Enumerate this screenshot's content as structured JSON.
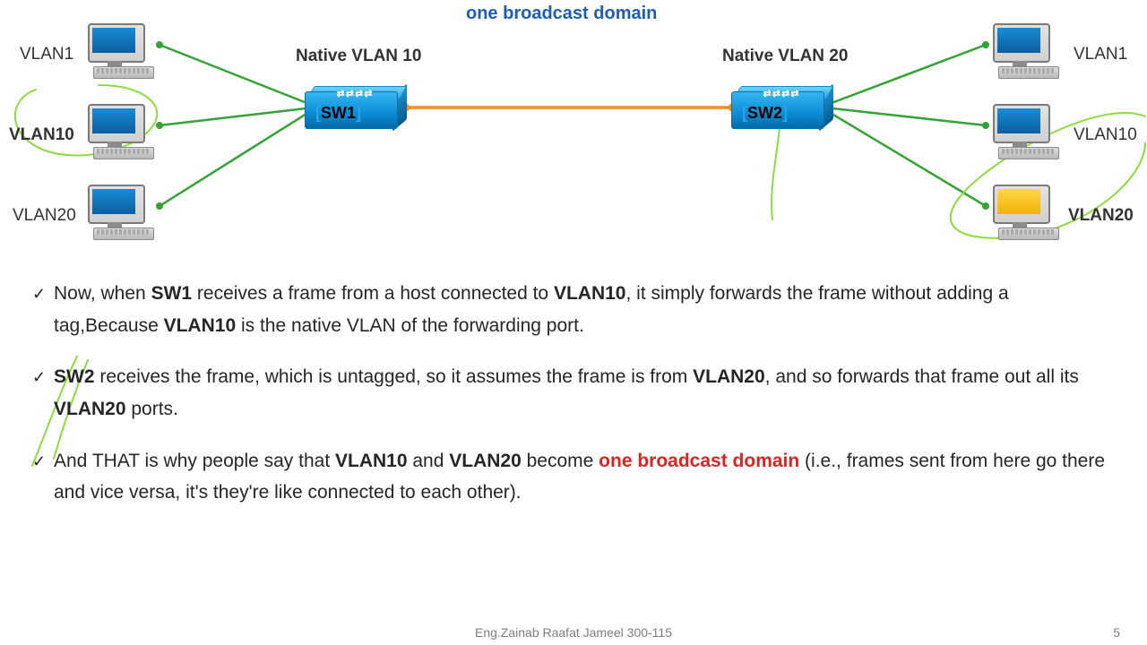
{
  "title": "one broadcast domain",
  "left_pcs": {
    "vlan1": "VLAN1",
    "vlan10": "VLAN10",
    "vlan20": "VLAN20"
  },
  "right_pcs": {
    "vlan1": "VLAN1",
    "vlan10": "VLAN10",
    "vlan20": "VLAN20"
  },
  "sw1": {
    "native": "Native VLAN 10",
    "name": "SW1"
  },
  "sw2": {
    "native": "Native VLAN 20",
    "name": "SW2"
  },
  "bullets": {
    "b1_a": "Now, when ",
    "b1_sw1": "SW1",
    "b1_b": " receives a frame from a host connected to ",
    "b1_v10a": "VLAN10",
    "b1_c": ", it simply forwards the frame without adding a tag,Because ",
    "b1_v10b": "VLAN10",
    "b1_d": " is the native VLAN of the forwarding port.",
    "b2_sw2": "SW2",
    "b2_a": " receives the frame, which is untagged, so it assumes the frame is from ",
    "b2_v20a": "VLAN20",
    "b2_b": ", and so forwards that frame out all its ",
    "b2_v20b": "VLAN20",
    "b2_c": " ports.",
    "b3_a": "And THAT is why people say that ",
    "b3_v10": "VLAN10",
    "b3_b": " and ",
    "b3_v20": "VLAN20",
    "b3_c": " become ",
    "b3_red": "one broadcast domain",
    "b3_d": " (i.e., frames sent from here go there and vice versa, it's they're like connected to each other)."
  },
  "footer": "Eng.Zainab Raafat Jameel  300-115",
  "page": "5",
  "diagram": {
    "switches": [
      {
        "id": "SW1",
        "native_vlan": 10,
        "pos": "left-center"
      },
      {
        "id": "SW2",
        "native_vlan": 20,
        "pos": "right-center"
      }
    ],
    "hosts": [
      {
        "side": "left",
        "vlan": 1,
        "label": "VLAN1",
        "connects": "SW1"
      },
      {
        "side": "left",
        "vlan": 10,
        "label": "VLAN10",
        "connects": "SW1",
        "highlighted": true
      },
      {
        "side": "left",
        "vlan": 20,
        "label": "VLAN20",
        "connects": "SW1"
      },
      {
        "side": "right",
        "vlan": 1,
        "label": "VLAN1",
        "connects": "SW2"
      },
      {
        "side": "right",
        "vlan": 10,
        "label": "VLAN10",
        "connects": "SW2"
      },
      {
        "side": "right",
        "vlan": 20,
        "label": "VLAN20",
        "connects": "SW2",
        "highlighted": true
      }
    ],
    "trunk": {
      "from": "SW1",
      "to": "SW2",
      "color": "orange"
    },
    "annotations": [
      "hand-circle around left VLAN10 PC",
      "hand-circle around right VLAN20 PC",
      "hand lines near bullet 2"
    ]
  }
}
